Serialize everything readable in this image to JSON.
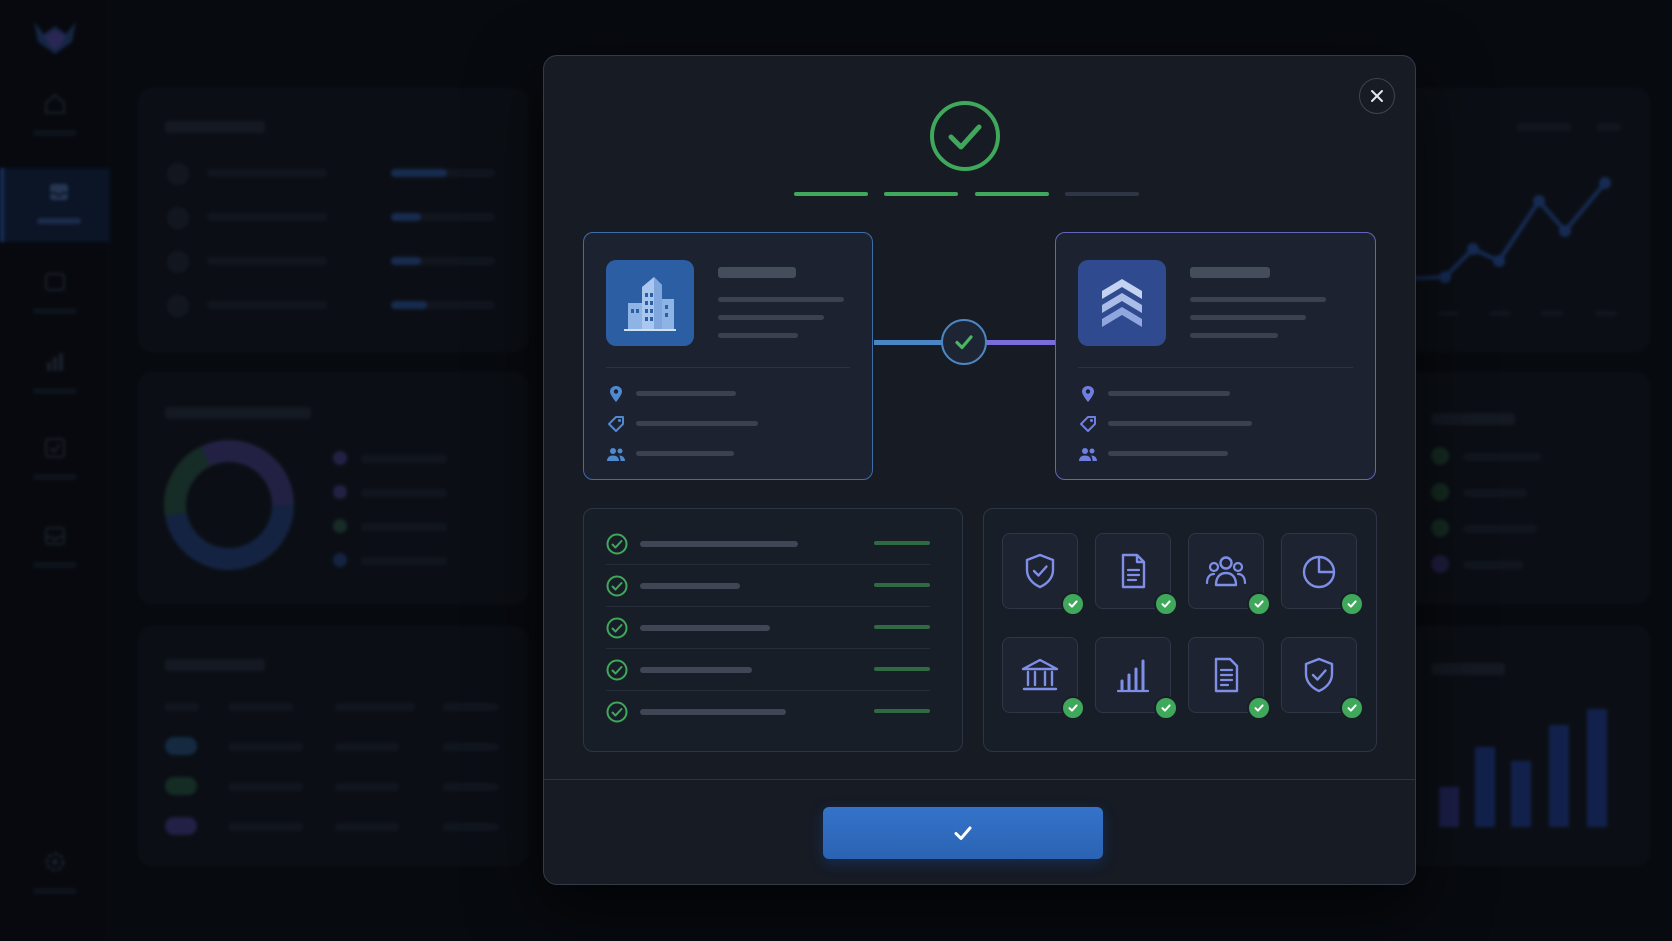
{
  "app": {
    "name": ""
  },
  "colors": {
    "background": "#0b0e14",
    "modal": "#161b24",
    "accent_blue": "#2f6bc0",
    "accent_purple": "#7a6ddb",
    "success_green": "#3fa85a"
  },
  "sidebar": {
    "logo_icon": "wolf-logo",
    "items": [
      {
        "icon": "home-icon",
        "active": false
      },
      {
        "icon": "inbox-icon",
        "active": true
      },
      {
        "icon": "box-icon",
        "active": false
      },
      {
        "icon": "bar-chart-icon",
        "active": false
      },
      {
        "icon": "checkbox-icon",
        "active": false
      },
      {
        "icon": "inbox-icon",
        "active": false
      }
    ],
    "footer_icon": "gear-icon"
  },
  "modal": {
    "status_icon": "check-circle-icon",
    "progress": {
      "total_steps": 4,
      "completed_steps": 3
    },
    "source_entity": {
      "icon": "building-icon",
      "meta_icons": [
        "location-pin-icon",
        "tag-icon",
        "users-icon"
      ]
    },
    "target_entity": {
      "icon": "layers-icon",
      "meta_icons": [
        "location-pin-icon",
        "tag-icon",
        "users-icon"
      ]
    },
    "link_icon": "check-icon",
    "checklist": {
      "item_count": 5,
      "item_icon": "check-circle-icon"
    },
    "features": [
      {
        "icon": "shield-check-icon",
        "verified": true
      },
      {
        "icon": "document-icon",
        "verified": true
      },
      {
        "icon": "users-group-icon",
        "verified": true
      },
      {
        "icon": "pie-chart-icon",
        "verified": true
      },
      {
        "icon": "bank-icon",
        "verified": true
      },
      {
        "icon": "bar-chart-icon",
        "verified": true
      },
      {
        "icon": "document-list-icon",
        "verified": true
      },
      {
        "icon": "shield-check-icon",
        "verified": true
      }
    ],
    "close_icon": "close-icon",
    "confirm_icon": "check-icon"
  }
}
